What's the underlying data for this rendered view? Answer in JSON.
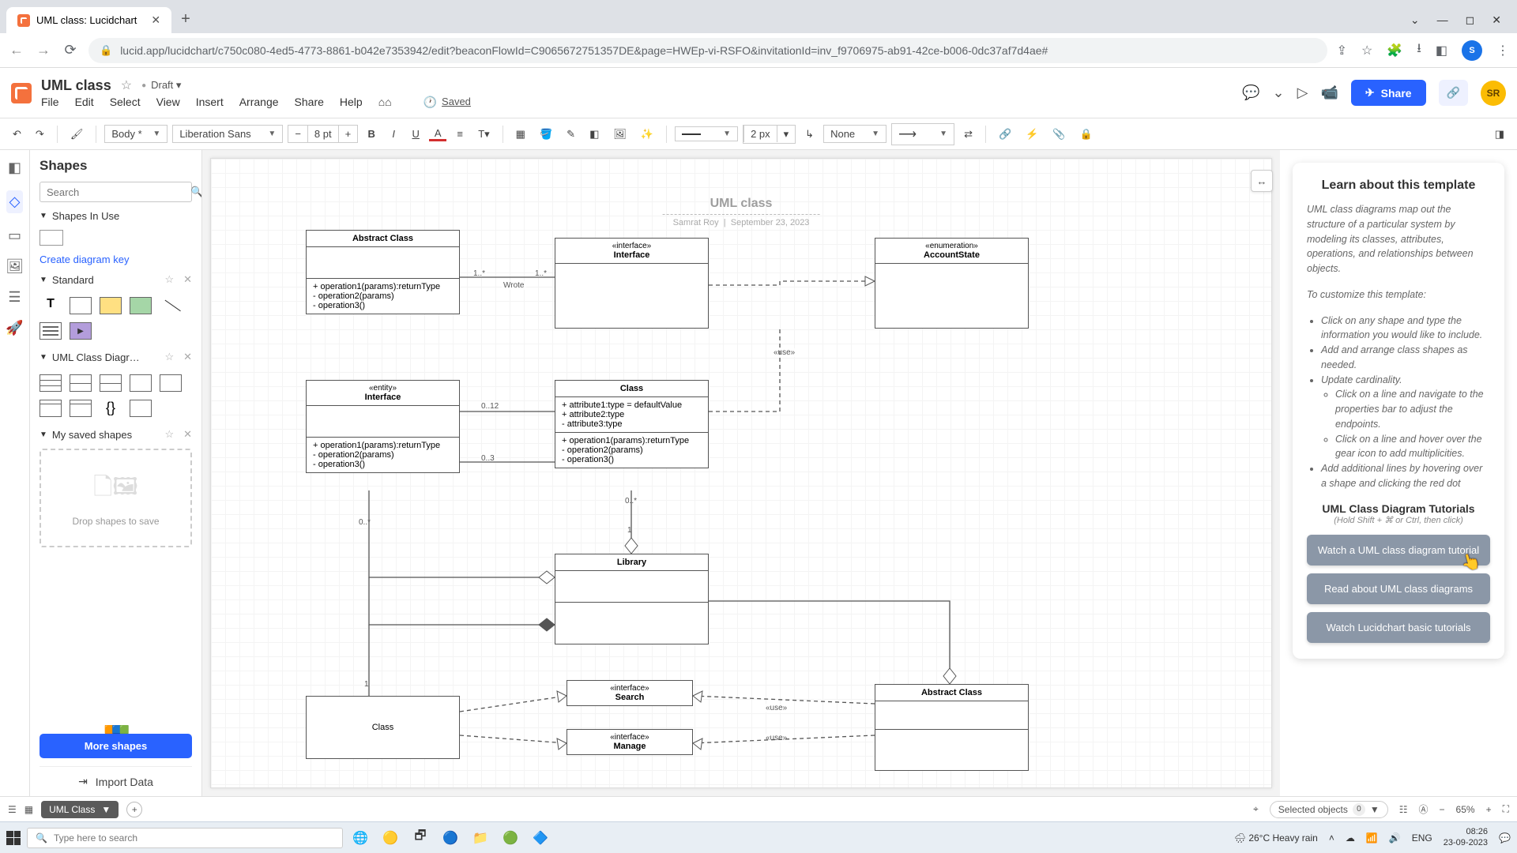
{
  "browser": {
    "tab_title": "UML class: Lucidchart",
    "url": "lucid.app/lucidchart/c750c080-4ed5-4773-8861-b042e7353942/edit?beaconFlowId=C9065672751357DE&page=HWEp-vi-RSFO&invitationId=inv_f9706975-ab91-42ce-b006-0dc37af7d4ae#",
    "avatar": "S"
  },
  "header": {
    "doc_title": "UML class",
    "status": "Draft ▾",
    "menus": [
      "File",
      "Edit",
      "Select",
      "View",
      "Insert",
      "Arrange",
      "Share",
      "Help"
    ],
    "saved": "Saved",
    "share": "Share",
    "avatar": "SR"
  },
  "toolbar": {
    "font_family": "Body *",
    "font_name": "Liberation Sans",
    "font_size": "8 pt",
    "line_width": "2 px",
    "line_style": "None"
  },
  "sidebar": {
    "title": "Shapes",
    "search_placeholder": "Search",
    "sections": {
      "in_use": "Shapes In Use",
      "key_link": "Create diagram key",
      "standard": "Standard",
      "uml": "UML Class Diagr…",
      "saved": "My saved shapes"
    },
    "drop_hint": "Drop shapes to save",
    "more": "More shapes",
    "import": "Import Data"
  },
  "canvas": {
    "title": "UML class",
    "subtitle_author": "Samrat Roy",
    "subtitle_date": "September 23, 2023",
    "nodes": {
      "abstract1": {
        "name": "Abstract Class",
        "ops": [
          "+ operation1(params):returnType",
          "- operation2(params)",
          "- operation3()"
        ]
      },
      "interface1": {
        "stereo": "«interface»",
        "name": "Interface"
      },
      "account": {
        "stereo": "«enumeration»",
        "name": "AccountState"
      },
      "entity": {
        "stereo": "«entity»",
        "name": "Interface",
        "ops": [
          "+ operation1(params):returnType",
          "- operation2(params)",
          "- operation3()"
        ]
      },
      "class1": {
        "name": "Class",
        "attrs": [
          "+ attribute1:type = defaultValue",
          "+ attribute2:type",
          "- attribute3:type"
        ],
        "ops": [
          "+ operation1(params):returnType",
          "- operation2(params)",
          "- operation3()"
        ]
      },
      "library": {
        "name": "Library"
      },
      "class2": {
        "name": "Class"
      },
      "search": {
        "stereo": "«interface»",
        "name": "Search"
      },
      "manage": {
        "stereo": "«interface»",
        "name": "Manage"
      },
      "abstract2": {
        "name": "Abstract Class"
      }
    },
    "labels": {
      "m1a": "1..*",
      "m1b": "1..*",
      "wrote": "Wrote",
      "m012": "0..12",
      "m03": "0..3",
      "m0s": "0..*",
      "m0s2": "0..*",
      "one1": "1",
      "one2": "1",
      "use1": "«use»",
      "use2": "«use»",
      "use3": "«use»"
    }
  },
  "info": {
    "title": "Learn about this template",
    "p1": "UML class diagrams map out the structure of a particular system by modeling its classes, attributes, operations, and relationships between objects.",
    "p2": "To customize this template:",
    "b1": "Click on any shape and type the information you would like to include.",
    "b2": "Add and arrange class shapes as needed.",
    "b3": "Update cardinality.",
    "b3a": "Click on a line and navigate to the properties bar to adjust the endpoints.",
    "b3b": "Click on a line and hover over the gear icon to add multiplicities.",
    "b4": "Add additional lines by hovering over a shape and clicking the red dot",
    "sub": "UML Class Diagram Tutorials",
    "hint": "(Hold Shift + ⌘ or Ctrl, then click)",
    "btn1": "Watch a UML class diagram tutorial",
    "btn2": "Read about UML class diagrams",
    "btn3": "Watch Lucidchart basic tutorials"
  },
  "footer": {
    "page_tab": "UML Class",
    "selected": "Selected objects",
    "selected_count": "0",
    "zoom": "65%"
  },
  "taskbar": {
    "search": "Type here to search",
    "weather": "26°C  Heavy rain",
    "time": "08:26",
    "date": "23-09-2023"
  }
}
